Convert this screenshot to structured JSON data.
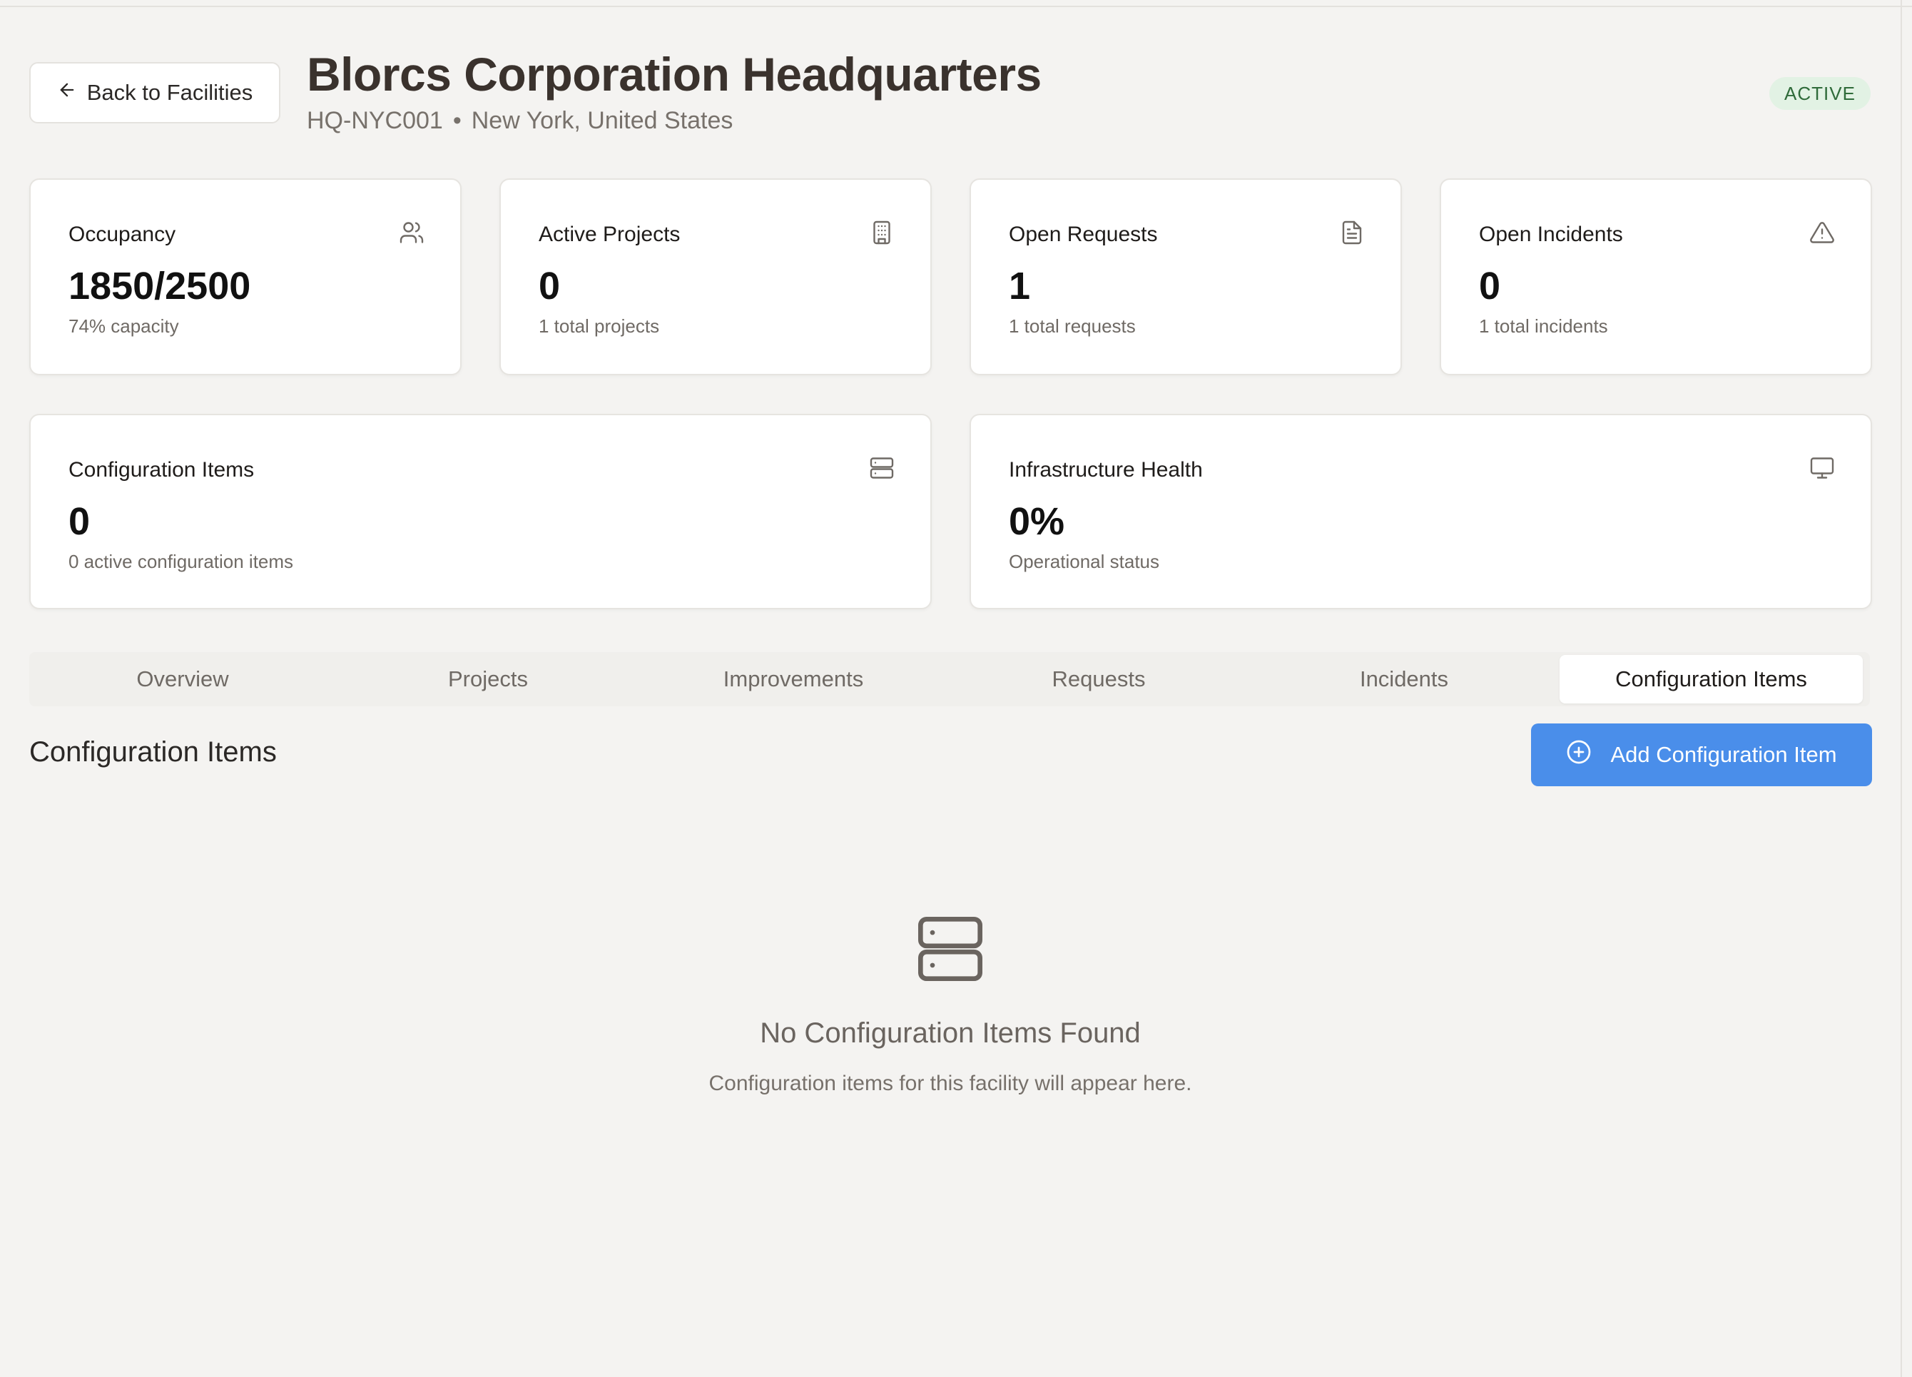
{
  "header": {
    "back_label": "Back to Facilities",
    "title": "Blorcs Corporation Headquarters",
    "code": "HQ-NYC001",
    "separator": "•",
    "location": "New York, United States",
    "status": "ACTIVE"
  },
  "stats": [
    {
      "label": "Occupancy",
      "value": "1850/2500",
      "sub": "74% capacity",
      "icon": "users-icon"
    },
    {
      "label": "Active Projects",
      "value": "0",
      "sub": "1 total projects",
      "icon": "building-icon"
    },
    {
      "label": "Open Requests",
      "value": "1",
      "sub": "1 total requests",
      "icon": "document-icon"
    },
    {
      "label": "Open Incidents",
      "value": "0",
      "sub": "1 total incidents",
      "icon": "alert-triangle-icon"
    },
    {
      "label": "Configuration Items",
      "value": "0",
      "sub": "0 active configuration items",
      "icon": "server-icon"
    },
    {
      "label": "Infrastructure Health",
      "value": "0%",
      "sub": "Operational status",
      "icon": "monitor-icon"
    }
  ],
  "tabs": [
    {
      "label": "Overview"
    },
    {
      "label": "Projects"
    },
    {
      "label": "Improvements"
    },
    {
      "label": "Requests"
    },
    {
      "label": "Incidents"
    },
    {
      "label": "Configuration Items"
    }
  ],
  "active_tab": "Configuration Items",
  "section": {
    "title": "Configuration Items",
    "add_label": "Add Configuration Item"
  },
  "empty": {
    "icon": "server-icon",
    "title": "No Configuration Items Found",
    "subtitle": "Configuration items for this facility will appear here."
  },
  "colors": {
    "accent": "#4a8eea",
    "status_bg": "#e2f2e4",
    "status_text": "#2f6b3a",
    "page_bg": "#f4f3f1"
  }
}
